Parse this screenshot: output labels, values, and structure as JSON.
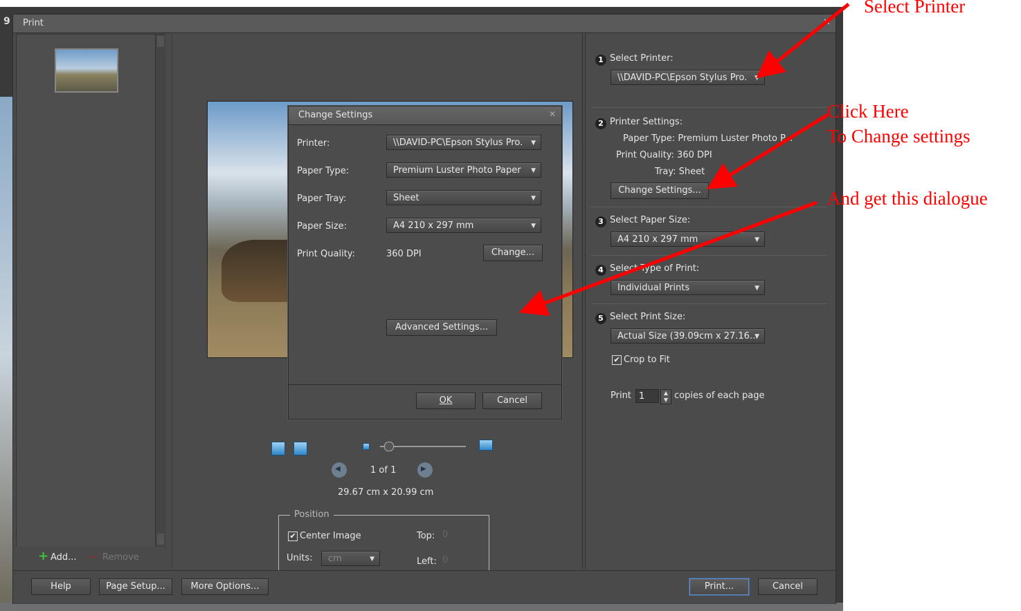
{
  "window": {
    "title": "Print",
    "title_prefix": "9"
  },
  "left_panel": {
    "add_label": "Add...",
    "remove_label": "Remove"
  },
  "preview": {
    "page_indicator": "1 of 1",
    "dimensions": "29.67 cm x 20.99 cm",
    "zoom_level": 0.0
  },
  "position": {
    "legend": "Position",
    "center_image_label": "Center Image",
    "center_image_checked": true,
    "units_label": "Units:",
    "units_value": "cm",
    "top_label": "Top:",
    "top_value": "0",
    "left_label": "Left:",
    "left_value": "0"
  },
  "dialog": {
    "title": "Change Settings",
    "printer_label": "Printer:",
    "printer_value": "\\\\DAVID-PC\\Epson Stylus Pro.",
    "paper_type_label": "Paper Type:",
    "paper_type_value": "Premium Luster Photo Paper",
    "paper_tray_label": "Paper Tray:",
    "paper_tray_value": "Sheet",
    "paper_size_label": "Paper Size:",
    "paper_size_value": "A4 210 x 297 mm",
    "print_quality_label": "Print Quality:",
    "print_quality_value": "360 DPI",
    "change_button": "Change...",
    "advanced_button": "Advanced Settings...",
    "ok_button": "OK",
    "cancel_button": "Cancel"
  },
  "right_panel": {
    "step1": {
      "num": "1",
      "label": "Select Printer:",
      "value": "\\\\DAVID-PC\\Epson Stylus Pro."
    },
    "step2": {
      "num": "2",
      "label": "Printer Settings:",
      "paper_type": "Paper Type: Premium Luster Photo P...",
      "print_quality": "Print Quality: 360 DPI",
      "tray": "Tray: Sheet",
      "change_button": "Change Settings..."
    },
    "step3": {
      "num": "3",
      "label": "Select Paper Size:",
      "value": "A4 210 x 297 mm"
    },
    "step4": {
      "num": "4",
      "label": "Select Type of Print:",
      "value": "Individual Prints"
    },
    "step5": {
      "num": "5",
      "label": "Select Print Size:",
      "value": "Actual Size (39.09cm x 27.16...",
      "crop_label": "Crop to Fit",
      "crop_checked": true
    },
    "copies": {
      "before": "Print",
      "value": "1",
      "after": "copies of each page"
    }
  },
  "bottom_bar": {
    "help": "Help",
    "page_setup": "Page Setup...",
    "more_options": "More Options...",
    "print": "Print...",
    "cancel": "Cancel"
  },
  "annotations": {
    "select_printer": "Select Printer",
    "click_here": "Click Here",
    "to_change": "To Change settings",
    "and_get": "And get this dialogue",
    "color": "#ff0000"
  }
}
